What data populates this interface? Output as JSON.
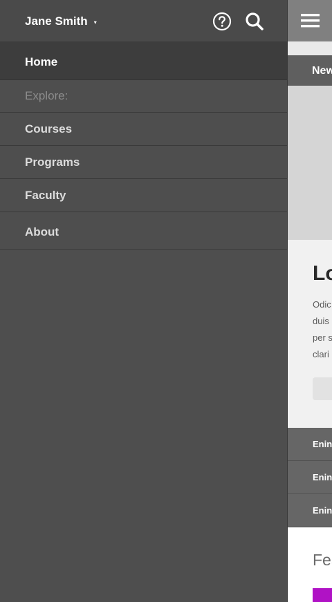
{
  "drawer": {
    "user_name": "Jane Smith",
    "caret": "▾",
    "icons": {
      "help": "help-circle-icon",
      "search": "search-icon"
    },
    "nav": {
      "home": "Home",
      "explore": "Explore:",
      "courses": "Courses",
      "programs": "Programs",
      "faculty": "Faculty",
      "about": "About"
    }
  },
  "page": {
    "menu_icon": "hamburger-menu-icon",
    "news_tab": "New",
    "card": {
      "title": "Lo",
      "lines": [
        "Odic",
        "duis",
        "per s",
        "clari"
      ]
    },
    "links": [
      "Enin",
      "Enin",
      "Enin"
    ],
    "featured_title": "Fea"
  },
  "colors": {
    "drawer_bg": "#4e4e4e",
    "active_item_bg": "#3d3d3d",
    "accent": "#b012c5"
  }
}
